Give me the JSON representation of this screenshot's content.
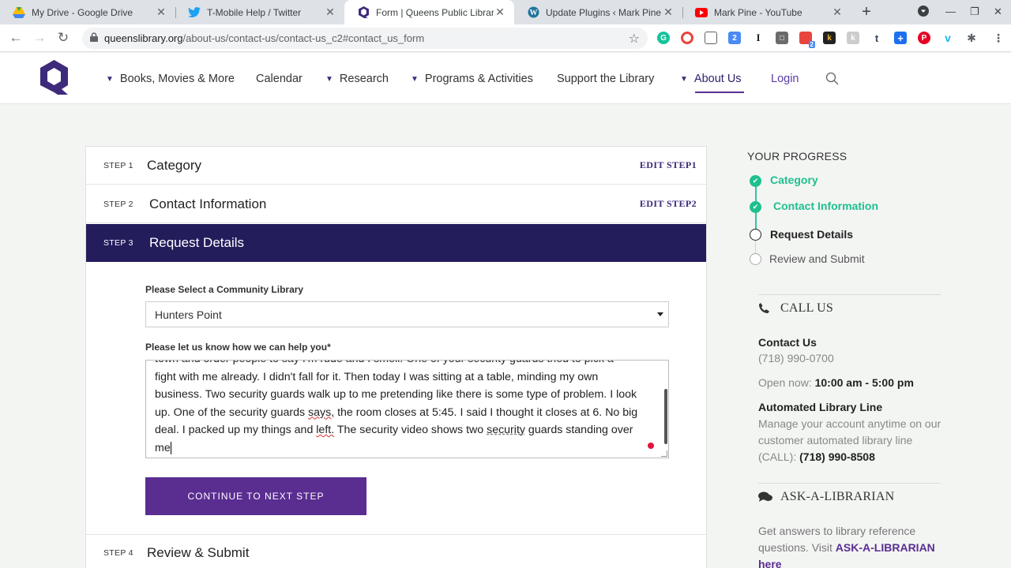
{
  "browser": {
    "tabs": [
      {
        "title": "My Drive - Google Drive",
        "icon": "google-drive-icon"
      },
      {
        "title": "T-Mobile Help / Twitter",
        "icon": "twitter-icon"
      },
      {
        "title": "Form | Queens Public Library",
        "icon": "queens-library-icon"
      },
      {
        "title": "Update Plugins ‹ Mark Pine —",
        "icon": "wordpress-icon"
      },
      {
        "title": "Mark Pine - YouTube",
        "icon": "youtube-icon"
      }
    ],
    "url_host": "queenslibrary.org",
    "url_path": "/about-us/contact-us/contact-us_c2#contact_us_form",
    "extension_badge": "2"
  },
  "site": {
    "nav": {
      "books": "Books, Movies & More",
      "calendar": "Calendar",
      "research": "Research",
      "programs": "Programs & Activities",
      "support": "Support the Library",
      "about": "About Us",
      "login": "Login"
    }
  },
  "form": {
    "steps": [
      {
        "num": "STEP 1",
        "title": "Category",
        "edit": "EDIT STEP1"
      },
      {
        "num": "STEP 2",
        "title": "Contact Information",
        "edit": "EDIT STEP2"
      },
      {
        "num": "STEP 3",
        "title": "Request Details"
      },
      {
        "num": "STEP 4",
        "title": "Review & Submit"
      }
    ],
    "library_label": "Please Select a Community Library",
    "library_value": "Hunters Point",
    "help_label": "Please let us know how we can help you*",
    "message_lines": {
      "l1": "town and order people to say I'm rude and I smell. One of your security guards tried to pick a",
      "l2": "fight with me already. I didn't fall for it. Then today I was sitting at a table, minding my own",
      "l3": "business. Two security guards walk up to me pretending like there is some type of problem. I look",
      "l4a": "up. One of the security guards ",
      "l4b": "says,",
      "l4c": " the room closes at 5:45. I said I thought it closes at 6. No big",
      "l5a": "deal. I packed up my things and ",
      "l5b": "left.",
      "l5c": " The security video shows two ",
      "l5d": "security",
      "l5e": " guards standing over",
      "l6": "me"
    },
    "continue_label": "CONTINUE TO NEXT STEP"
  },
  "progress": {
    "title": "YOUR PROGRESS",
    "items": [
      {
        "label": "Category",
        "state": "done"
      },
      {
        "label": "Contact Information",
        "state": "done"
      },
      {
        "label": "Request Details",
        "state": "current"
      },
      {
        "label": "Review and Submit",
        "state": "pending"
      }
    ]
  },
  "sidebar": {
    "call_us": "CALL US",
    "contact_title": "Contact Us",
    "contact_phone": "(718) 990-0700",
    "open_now_label": "Open now:",
    "open_hours": "10:00 am - 5:00 pm",
    "automated_title": "Automated Library Line",
    "automated_text": "Manage your account anytime on our customer automated library line (CALL):",
    "automated_phone": "(718) 990-8508",
    "ask_title": "ASK-A-LIBRARIAN",
    "ask_text": "Get answers to library reference questions. Visit",
    "ask_link": "ASK-A-LIBRARIAN",
    "ask_here": "here"
  }
}
